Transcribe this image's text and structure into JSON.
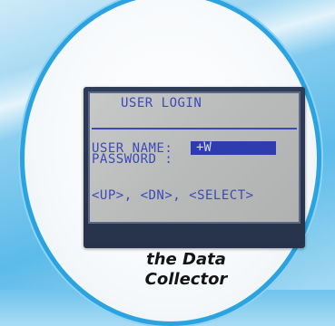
{
  "screen": {
    "title": "USER LOGIN",
    "username_label": "USER NAME:",
    "username_value": "+W",
    "password_label": "PASSWORD :",
    "keys_hint": "<UP>, <DN>, <SELECT>"
  },
  "caption": {
    "line1": "the Data",
    "line2": "Collector"
  },
  "colors": {
    "lcd_text": "#3c49b6",
    "lcd_background": "#bcbebd",
    "highlight": "#2f3cb0",
    "ring": "#2aa3e0"
  }
}
